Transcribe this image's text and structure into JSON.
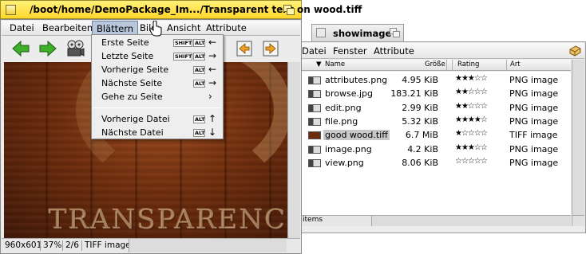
{
  "viewer": {
    "title": "/boot/home/DemoPackage_Im.../Transparent text on wood.tiff",
    "menu": [
      "Datei",
      "Bearbeiten",
      "Blättern",
      "Bild",
      "Ansicht",
      "Attribute"
    ],
    "image_text": "TRANSPARENC",
    "status": {
      "resolution": "960x601",
      "zoom": "37%",
      "page": "2/6",
      "type": "TIFF image"
    }
  },
  "browse_menu": {
    "items": [
      {
        "label": "Erste Seite",
        "keys": [
          "SHIFT",
          "ALT"
        ],
        "arrow": "←"
      },
      {
        "label": "Letzte Seite",
        "keys": [
          "SHIFT",
          "ALT"
        ],
        "arrow": "→"
      },
      {
        "label": "Vorherige Seite",
        "keys": [
          "ALT"
        ],
        "arrow": "←"
      },
      {
        "label": "Nächste Seite",
        "keys": [
          "ALT"
        ],
        "arrow": "→"
      },
      {
        "label": "Gehe zu Seite",
        "keys": [],
        "arrow": "›"
      },
      {
        "label": "Vorherige Datei",
        "keys": [
          "ALT"
        ],
        "arrow": "↑"
      },
      {
        "label": "Nächste Datei",
        "keys": [
          "ALT"
        ],
        "arrow": "↓"
      }
    ]
  },
  "tracker": {
    "title": "showimage",
    "menu": [
      "Datei",
      "Fenster",
      "Attribute"
    ],
    "columns": [
      "Name",
      "Größe",
      "Rating",
      "Art"
    ],
    "files": [
      {
        "name": "attributes.png",
        "size": "4.95 KiB",
        "rating": "★★★☆☆",
        "kind": "PNG image",
        "selected": false
      },
      {
        "name": "browse.jpg",
        "size": "183.21 KiB",
        "rating": "★★☆☆☆",
        "kind": "PNG image",
        "selected": false
      },
      {
        "name": "edit.png",
        "size": "2.99 KiB",
        "rating": "★★☆☆☆",
        "kind": "PNG image",
        "selected": false
      },
      {
        "name": "file.png",
        "size": "5.32 KiB",
        "rating": "★★★★☆",
        "kind": "PNG image",
        "selected": false
      },
      {
        "name": "good wood.tiff",
        "size": "6.7 MiB",
        "rating": "★☆☆☆☆",
        "kind": "TIFF image",
        "selected": true
      },
      {
        "name": "image.png",
        "size": "4.2 KiB",
        "rating": "★★★☆☆",
        "kind": "PNG image",
        "selected": false
      },
      {
        "name": "view.png",
        "size": "8.06 KiB",
        "rating": "☆☆☆☆☆",
        "kind": "PNG image",
        "selected": false
      }
    ],
    "status": "items"
  },
  "colors": {
    "active_tab": "#ffd72a",
    "menu_highlight": "#b9c7dc",
    "arrow_green": "#3fae2a",
    "arrow_orange": "#f0a020"
  }
}
